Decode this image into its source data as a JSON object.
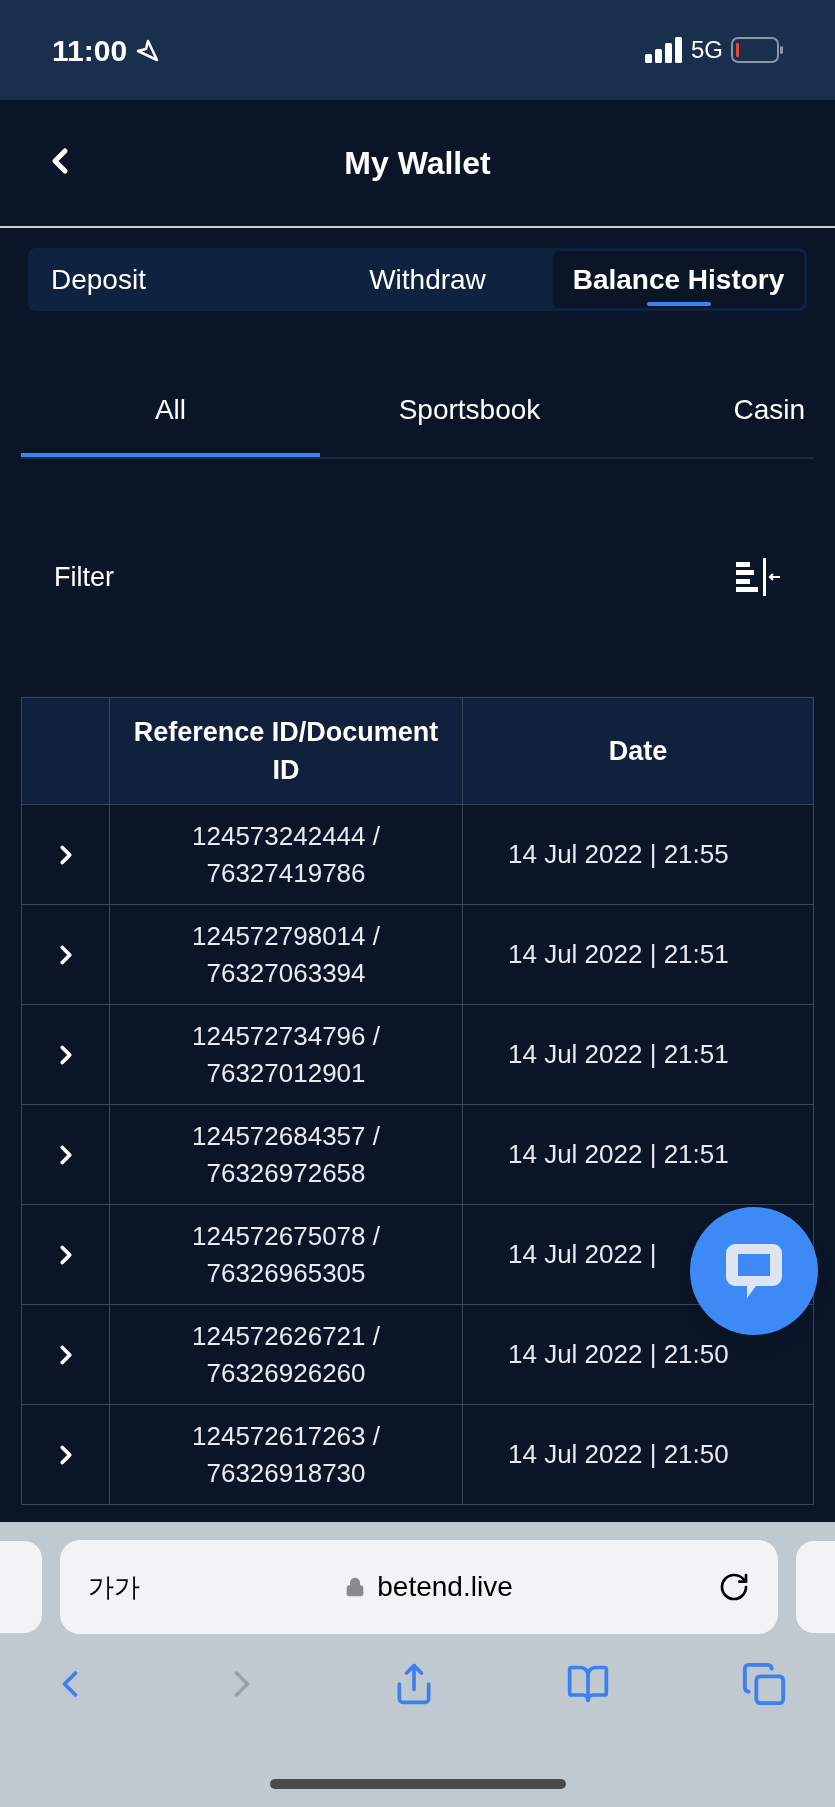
{
  "status_bar": {
    "time": "11:00",
    "network": "5G"
  },
  "header": {
    "title": "My Wallet"
  },
  "tabs": [
    {
      "label": "Deposit",
      "selected": false
    },
    {
      "label": "Withdraw",
      "selected": false
    },
    {
      "label": "Balance History",
      "selected": true
    }
  ],
  "subtabs": [
    {
      "label": "All",
      "selected": true
    },
    {
      "label": "Sportsbook",
      "selected": false
    },
    {
      "label": "Casin",
      "selected": false
    }
  ],
  "filter": {
    "label": "Filter"
  },
  "table": {
    "columns": [
      "",
      "Reference ID/Document ID",
      "Date"
    ],
    "rows": [
      {
        "reference": "124573242444 / 76327419786",
        "date": "14 Jul 2022 | 21:55"
      },
      {
        "reference": "124572798014 / 76327063394",
        "date": "14 Jul 2022 | 21:51"
      },
      {
        "reference": "124572734796 / 76327012901",
        "date": "14 Jul 2022 | 21:51"
      },
      {
        "reference": "124572684357 / 76326972658",
        "date": "14 Jul 2022 | 21:51"
      },
      {
        "reference": "124572675078 / 76326965305",
        "date": "14 Jul 2022 |"
      },
      {
        "reference": "124572626721 / 76326926260",
        "date": "14 Jul 2022 | 21:50"
      },
      {
        "reference": "124572617263 / 76326918730",
        "date": "14 Jul 2022 | 21:50"
      }
    ]
  },
  "browser": {
    "text_size": "가가",
    "url": "betend.live"
  }
}
